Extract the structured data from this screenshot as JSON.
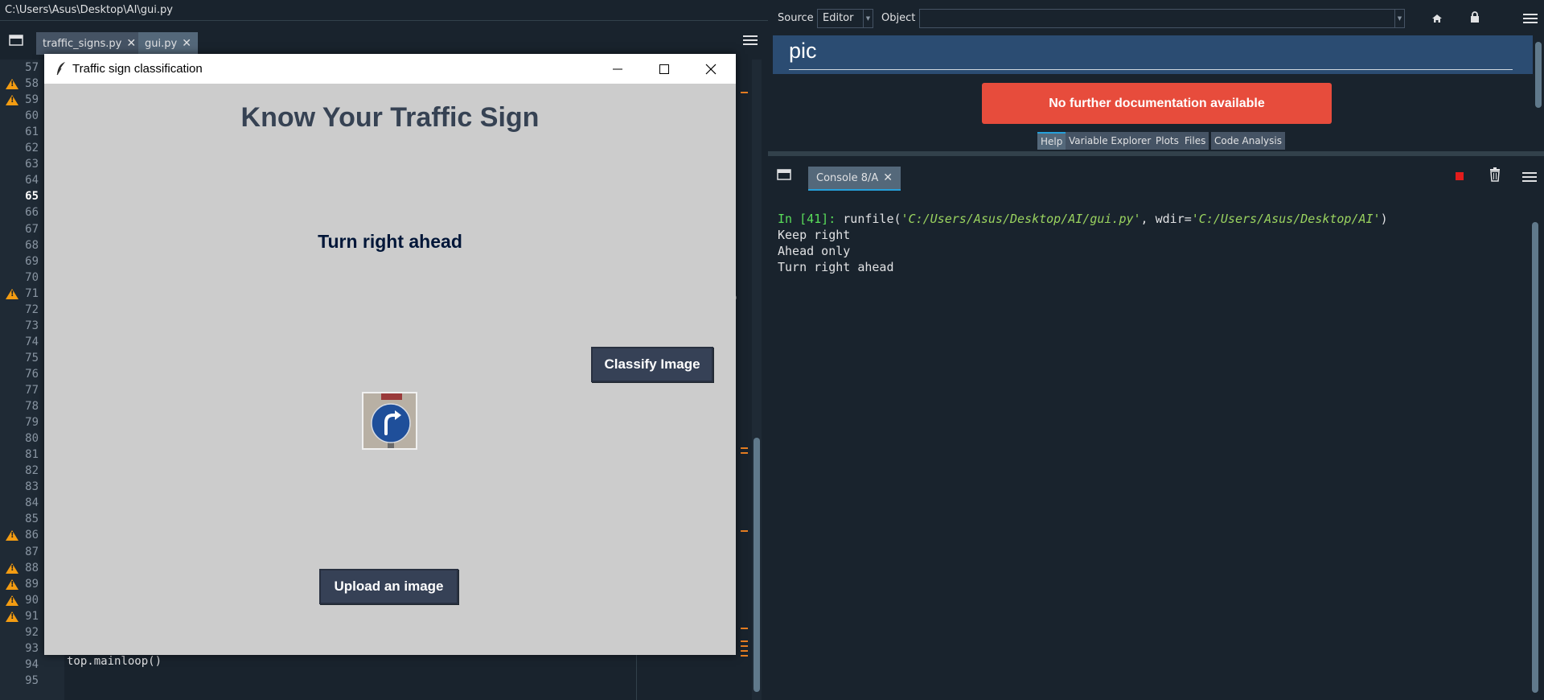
{
  "editor": {
    "file_path": "C:\\Users\\Asus\\Desktop\\AI\\gui.py",
    "tabs": [
      {
        "label": "traffic_signs.py",
        "close": "✕"
      },
      {
        "label": "gui.py",
        "close": "✕"
      }
    ],
    "line_numbers": [
      "57",
      "58",
      "59",
      "60",
      "61",
      "62",
      "63",
      "64",
      "65",
      "66",
      "67",
      "68",
      "69",
      "70",
      "71",
      "72",
      "73",
      "74",
      "75",
      "76",
      "77",
      "78",
      "79",
      "80",
      "81",
      "82",
      "83",
      "84",
      "85",
      "86",
      "87",
      "88",
      "89",
      "90",
      "91",
      "92",
      "93",
      "94",
      "95"
    ],
    "current_line": "65",
    "warning_lines": [
      "58",
      "59",
      "71",
      "86",
      "88",
      "89",
      "90",
      "91"
    ],
    "visible_code": {
      "line_94": "top.mainloop()",
      "line_71_fragment": "p"
    }
  },
  "tk_window": {
    "title": "Traffic sign classification",
    "heading": "Know Your Traffic Sign",
    "result": "Turn right ahead",
    "classify_button": "Classify Image",
    "upload_button": "Upload an image",
    "image_icon": "turn-right-ahead-sign-icon"
  },
  "help_pane": {
    "source_label": "Source",
    "source_value": "Editor",
    "object_label": "Object",
    "object_value": "",
    "title": "pic",
    "no_doc_message": "No further documentation available",
    "tabs": [
      "Help",
      "Variable Explorer",
      "Plots",
      "Files",
      "Code Analysis"
    ],
    "active_tab": "Help"
  },
  "console": {
    "tab_label": "Console 8/A",
    "tab_close": "✕",
    "prompt": "In [41]:",
    "command_prefix": "runfile(",
    "arg1": "'C:/Users/Asus/Desktop/AI/gui.py'",
    "sep": ", wdir=",
    "arg2": "'C:/Users/Asus/Desktop/AI'",
    "command_suffix": ")",
    "output": [
      "Keep right",
      "Ahead only",
      "Turn right ahead"
    ]
  },
  "colors": {
    "background": "#19232d",
    "tab": "#455364",
    "tk_bg": "#cccccc",
    "tk_button": "#364156",
    "no_doc_red": "#e74c3c",
    "help_header": "#2b4c72",
    "warning": "#f39c12",
    "prompt_green": "#5ade5a"
  }
}
